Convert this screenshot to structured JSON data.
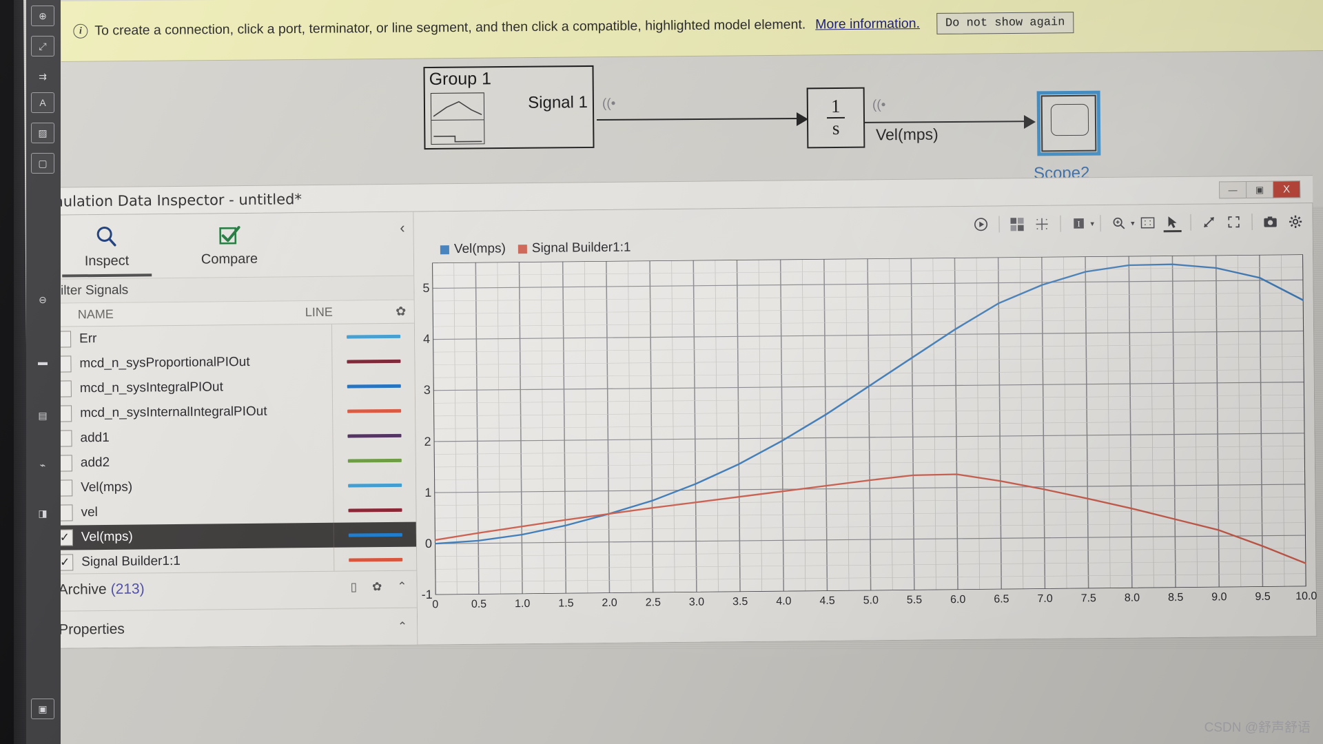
{
  "notification": {
    "icon": "info-icon",
    "message": "To create a connection, click a port, terminator, or line segment, and then click a compatible, highlighted model element.",
    "link_label": "More information.",
    "dismiss_label": "Do not show again"
  },
  "model": {
    "signal_builder": {
      "title": "Group 1",
      "output_port_label": "Signal 1"
    },
    "integrator": {
      "numerator": "1",
      "denominator": "s"
    },
    "integrator_signal_label": "Vel(mps)",
    "scope": {
      "label": "Scope2",
      "selection_color": "#2a86c8"
    }
  },
  "sdi_window": {
    "title": "Simulation Data Inspector - untitled*",
    "window_controls": {
      "minimize": "—",
      "maximize": "▣",
      "close": "X"
    },
    "tabs": [
      {
        "label": "Inspect",
        "icon": "search-icon",
        "active": true
      },
      {
        "label": "Compare",
        "icon": "checkbox-check-icon",
        "active": false
      }
    ],
    "collapse_icon": "chevron-left-icon",
    "filter_placeholder": "Filter Signals",
    "columns": {
      "name": "NAME",
      "line": "LINE",
      "settings_icon": "gear-icon"
    },
    "signals": [
      {
        "name": "Err",
        "color": "#3d9fd6",
        "checked": false,
        "selected": false
      },
      {
        "name": "mcd_n_sysProportionalPIOut",
        "color": "#7a1d2e",
        "checked": false,
        "selected": false
      },
      {
        "name": "mcd_n_sysIntegralPIOut",
        "color": "#1b6fc4",
        "checked": false,
        "selected": false
      },
      {
        "name": "mcd_n_sysInternalIntegralPIOut",
        "color": "#e1543a",
        "checked": false,
        "selected": false
      },
      {
        "name": "add1",
        "color": "#4d2a5e",
        "checked": false,
        "selected": false
      },
      {
        "name": "add2",
        "color": "#6a9e3c",
        "checked": false,
        "selected": false
      },
      {
        "name": "Vel(mps)",
        "color": "#3d9fd6",
        "checked": false,
        "selected": false
      },
      {
        "name": "vel",
        "color": "#8c2030",
        "checked": false,
        "selected": false
      },
      {
        "name": "Vel(mps)",
        "color": "#1b7fd4",
        "checked": true,
        "selected": true
      },
      {
        "name": "Signal Builder1:1",
        "color": "#e1543a",
        "checked": true,
        "selected": false
      }
    ],
    "archive": {
      "label": "Archive",
      "count": "(213)",
      "delete_icon": "trash-icon",
      "settings_icon": "gear-icon",
      "collapse_icon": "chevron-up-icon"
    },
    "properties": {
      "label": "Properties",
      "collapse_icon": "chevron-up-icon"
    },
    "plot_toolbar": [
      {
        "name": "run-replay-button",
        "glyph": "▶"
      },
      {
        "name": "subplot-layout-button",
        "glyph": "▦"
      },
      {
        "name": "grid-layout-button",
        "glyph": "⁙"
      },
      {
        "name": "cursor-data-button",
        "glyph": "❙"
      },
      {
        "name": "zoom-button",
        "glyph": "⌕"
      },
      {
        "name": "fit-to-view-button",
        "glyph": "⛶"
      },
      {
        "name": "pointer-tool-button",
        "glyph": "➤"
      },
      {
        "name": "pan-resize-button",
        "glyph": "⤢"
      },
      {
        "name": "fullscreen-button",
        "glyph": "⛶"
      },
      {
        "name": "snapshot-button",
        "glyph": "◉"
      },
      {
        "name": "settings-button",
        "glyph": "✿"
      }
    ]
  },
  "chart_data": {
    "type": "line",
    "title": "",
    "xlabel": "",
    "ylabel": "",
    "xlim": [
      0,
      10
    ],
    "ylim": [
      -1,
      5.5
    ],
    "grid": true,
    "legend_position": "top-left",
    "xticks": [
      "0",
      "0.5",
      "1.0",
      "1.5",
      "2.0",
      "2.5",
      "3.0",
      "3.5",
      "4.0",
      "4.5",
      "5.0",
      "5.5",
      "6.0",
      "6.5",
      "7.0",
      "7.5",
      "8.0",
      "8.5",
      "9.0",
      "9.5",
      "10.0"
    ],
    "yticks": [
      "-1",
      "0",
      "1",
      "2",
      "3",
      "4",
      "5"
    ],
    "x": [
      0,
      0.5,
      1.0,
      1.5,
      2.0,
      2.5,
      3.0,
      3.5,
      4.0,
      4.5,
      5.0,
      5.5,
      6.0,
      6.5,
      7.0,
      7.5,
      8.0,
      8.5,
      9.0,
      9.5,
      10.0
    ],
    "series": [
      {
        "name": "Vel(mps)",
        "color": "#3d7fc1",
        "values": [
          0.0,
          0.05,
          0.16,
          0.33,
          0.55,
          0.8,
          1.12,
          1.5,
          1.95,
          2.45,
          3.0,
          3.55,
          4.1,
          4.6,
          4.95,
          5.2,
          5.32,
          5.33,
          5.25,
          5.05,
          4.6
        ]
      },
      {
        "name": "Signal Builder1:1",
        "color": "#d4614f",
        "values": [
          0.07,
          0.2,
          0.32,
          0.44,
          0.55,
          0.66,
          0.76,
          0.86,
          0.96,
          1.06,
          1.16,
          1.25,
          1.26,
          1.12,
          0.95,
          0.76,
          0.56,
          0.34,
          0.12,
          -0.2,
          -0.55
        ]
      }
    ]
  },
  "watermark": "CSDN @舒声舒语"
}
